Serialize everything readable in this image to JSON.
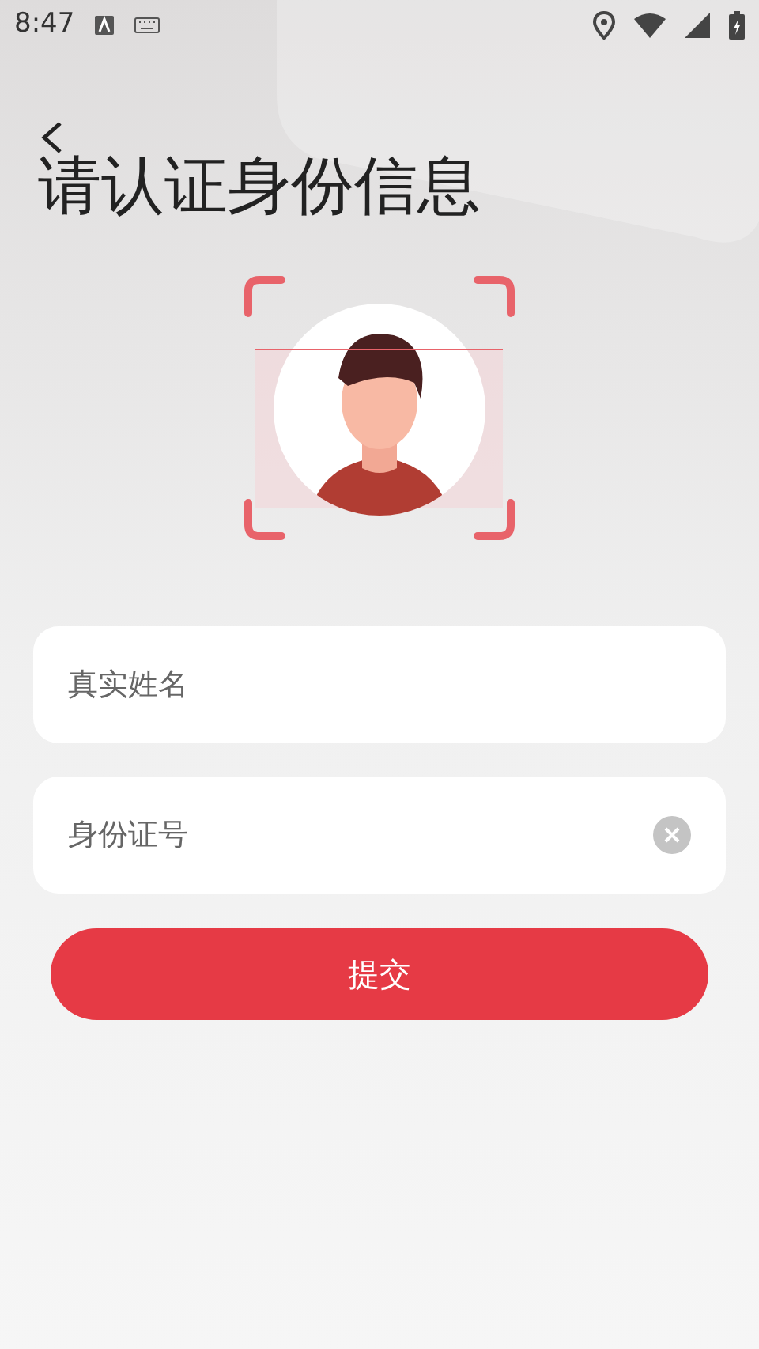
{
  "status_bar": {
    "time": "8:47"
  },
  "title": "请认证身份信息",
  "fields": [
    {
      "placeholder": "真实姓名",
      "clearable": false
    },
    {
      "placeholder": "身份证号",
      "clearable": true
    }
  ],
  "submit": "提交"
}
